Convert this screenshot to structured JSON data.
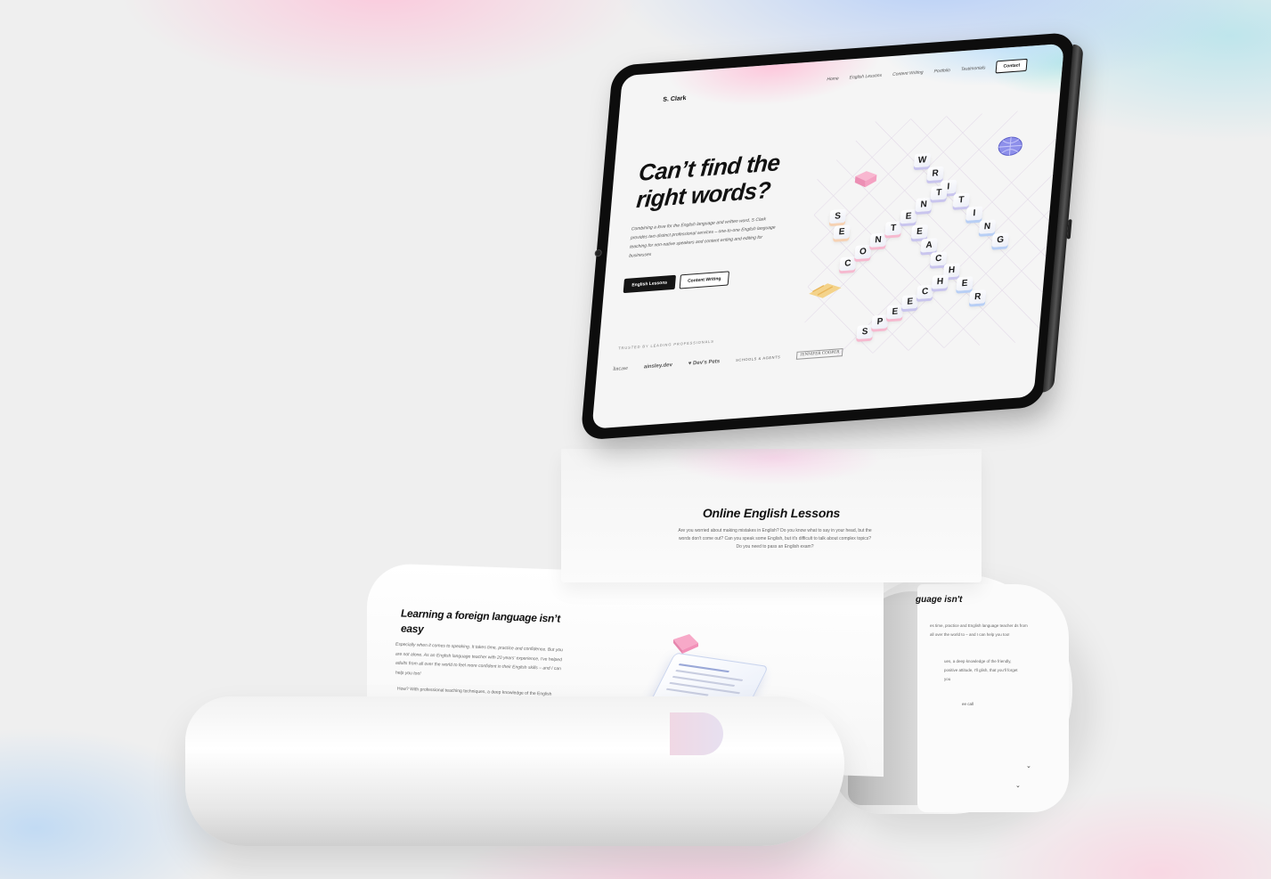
{
  "tablet": {
    "nav": {
      "logo": "S. Clark",
      "links": [
        "Home",
        "English Lessons",
        "Content Writing",
        "Portfolio",
        "Testimonials"
      ],
      "contact": "Contact"
    },
    "hero": {
      "title_line1": "Can’t find the",
      "title_line2": "right words?",
      "description": "Combining a love for the English language and written word, S Clark provides two distinct professional services – one-to-one English language teaching for non-native speakers and content writing and editing for businesses",
      "primary_button": "English Lessons",
      "secondary_button": "Content Writing"
    },
    "tiles": {
      "writing": [
        "W",
        "R",
        "I",
        "T",
        "I",
        "N",
        "G"
      ],
      "content": [
        "C",
        "O",
        "N",
        "T",
        "E",
        "N",
        "T"
      ],
      "seo": [
        "S",
        "E",
        "O"
      ],
      "teacher": [
        "E",
        "A",
        "C",
        "H",
        "E",
        "R"
      ],
      "speech": [
        "S",
        "P",
        "E",
        "E",
        "C",
        "H"
      ]
    },
    "trusted": {
      "label": "TRUSTED BY LEADING PROFESSIONALS",
      "clients": [
        "lincase",
        "ainsley.dev",
        "Dev's Pets",
        "SCHOOLS & AGENTS",
        "JENNIFER COOPER"
      ]
    }
  },
  "paper": {
    "section_title": "Online English Lessons",
    "section_text": "Are you worried about making mistakes in English? Do you know what to say in your head, but the words don't come out? Can you speak some English, but it's difficult to talk about complex topics? Do you need to pass an English exam?",
    "learn_title": "Learning a foreign language isn’t easy",
    "learn_text1": "Especially when it comes to speaking. It takes time, practice and confidence. But you are not alone. As an English language teacher with 20 years' experience, I've helped adults from all over the world to feel more confident in their English skills – and I can help you too!",
    "learn_text2": "How? With professional teaching techniques, a deep knowledge of the English language, a lot of patience, and a friendly, positive attitude, I'll help you feel so comfortable speaking English, that you'll forget you",
    "right_title": "guage isn't",
    "right_text1": "es time, practice and English language teacher ds from all over the world to – and I can help you too!",
    "right_text2": "ues, a deep knowledge of the friendly, positive attitude, I'll glish, that you'll forget you",
    "right_link": "ee call"
  },
  "colors": {
    "accent_dark": "#151515",
    "tile_purple": "#c9c5ee",
    "tile_pink": "#f6b9cf",
    "glow_pink": "#ffbed7",
    "glow_blue": "#aac8fa"
  }
}
